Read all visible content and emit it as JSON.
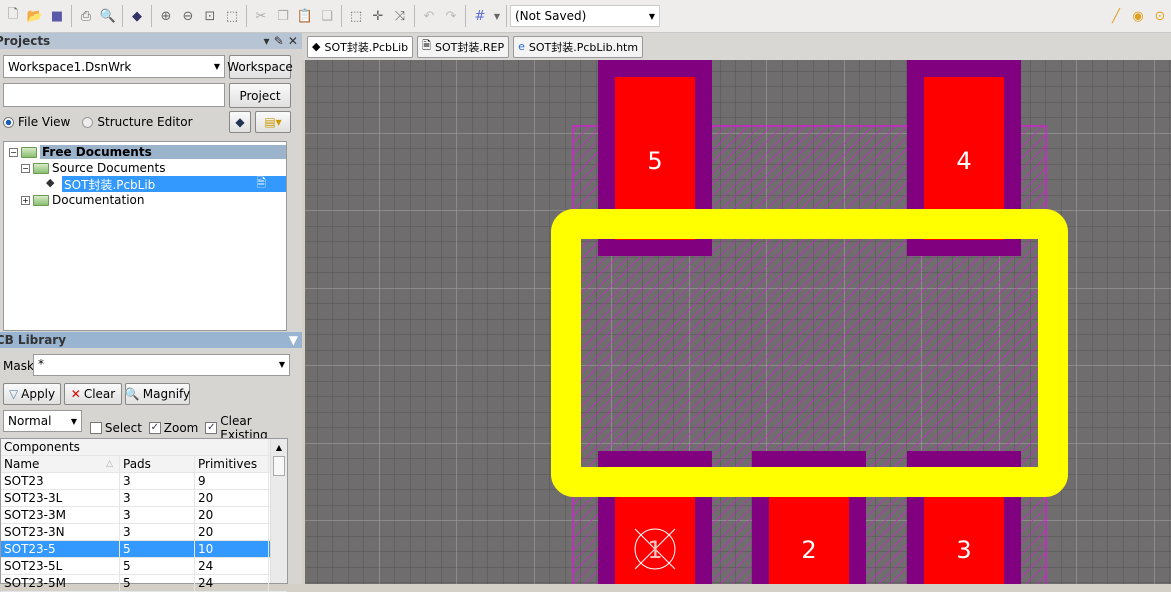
{
  "toolbar": {
    "document_combo": "(Not Saved)",
    "icons": [
      "new-icon",
      "open-icon",
      "save-icon",
      "print-icon",
      "print-preview-icon",
      "component-icon",
      "zoom-in-icon",
      "zoom-out-icon",
      "zoom-fit-icon",
      "zoom-area-icon",
      "cut-icon",
      "copy-icon",
      "paste-icon",
      "rubber-stamp-icon",
      "select-area-icon",
      "move-icon",
      "cross-select-icon",
      "undo-icon",
      "redo-icon",
      "grid-icon",
      "line-icon",
      "pad-icon",
      "via-icon"
    ]
  },
  "projects": {
    "title": "Projects",
    "workspace_value": "Workspace1.DsnWrk",
    "workspace_button": "Workspace",
    "project_value": "",
    "project_button": "Project",
    "file_view": "File View",
    "structure_editor": "Structure Editor",
    "tree": {
      "root": "Free Documents",
      "source": "Source Documents",
      "file": "SOT封装.PcbLib",
      "docs": "Documentation"
    }
  },
  "pcb_library": {
    "title": "PCB Library",
    "mask_label": "Mask",
    "mask_value": "*",
    "apply": "Apply",
    "clear": "Clear",
    "magnify": "Magnify",
    "mode": "Normal",
    "select": "Select",
    "zoom": "Zoom",
    "clear_existing": "Clear Existing",
    "select_checked": false,
    "zoom_checked": true,
    "clear_existing_checked": true,
    "components_header": "Components",
    "columns": [
      "Name",
      "Pads",
      "Primitives"
    ],
    "rows": [
      [
        "SOT23",
        "3",
        "9"
      ],
      [
        "SOT23-3L",
        "3",
        "20"
      ],
      [
        "SOT23-3M",
        "3",
        "20"
      ],
      [
        "SOT23-3N",
        "3",
        "20"
      ],
      [
        "SOT23-5",
        "5",
        "10"
      ],
      [
        "SOT23-5L",
        "5",
        "24"
      ],
      [
        "SOT23-5M",
        "5",
        "24"
      ]
    ],
    "selected_row": "SOT23-5"
  },
  "doc_tabs": [
    "SOT封装.PcbLib",
    "SOT封装.REP",
    "SOT封装.PcbLib.htm"
  ],
  "pcb": {
    "pads": [
      "1",
      "2",
      "3",
      "4",
      "5"
    ],
    "colors": {
      "pad": "#ff0000",
      "solder_mask": "#800080",
      "silkscreen": "#ffff00",
      "courtyard": "#ff00ff",
      "background": "#6f6d6d"
    }
  }
}
